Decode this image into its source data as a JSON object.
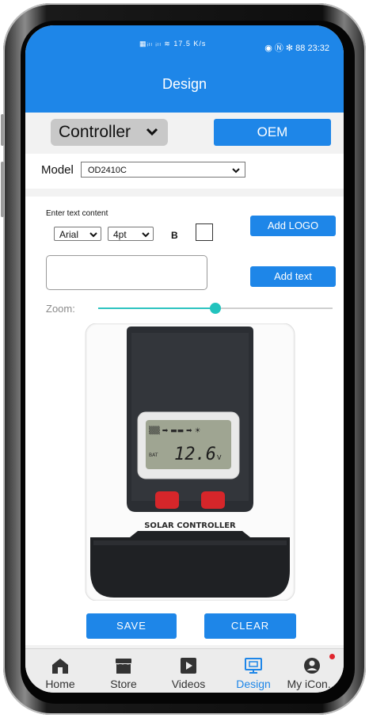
{
  "status_bar": {
    "left_icons_text": "▦ᵢₗₗ ᵢₗₗ ≋ 17.5 K/s",
    "right_icons_text": "◉ Ⓝ ✻ 88",
    "time": "23:32"
  },
  "appbar": {
    "title": "Design"
  },
  "product_select": {
    "value": "Controller"
  },
  "oem_label": "OEM",
  "model": {
    "label": "Model",
    "value": "OD2410C"
  },
  "text_section": {
    "label": "Enter text content",
    "font_value": "Arial",
    "size_value": "4pt",
    "bold_label": "B",
    "add_logo_label": "Add LOGO",
    "add_text_label": "Add text",
    "text_value": ""
  },
  "zoom": {
    "label": "Zoom:",
    "level": 0.5
  },
  "product_image": {
    "lcd_value": "12.6",
    "lcd_unit": "V",
    "lcd_bat": "BAT",
    "brand_text": "SOLAR CONTROLLER"
  },
  "actions": {
    "save_label": "SAVE",
    "clear_label": "CLEAR"
  },
  "nav": [
    {
      "label": "Home",
      "icon": "home-icon"
    },
    {
      "label": "Store",
      "icon": "store-icon"
    },
    {
      "label": "Videos",
      "icon": "play-icon"
    },
    {
      "label": "Design",
      "icon": "design-icon",
      "active": true
    },
    {
      "label": "My iCon...",
      "icon": "user-icon",
      "badge": true
    }
  ],
  "colors": {
    "primary": "#1e86e8",
    "slider": "#22c3bd",
    "badge": "#e0262e"
  }
}
